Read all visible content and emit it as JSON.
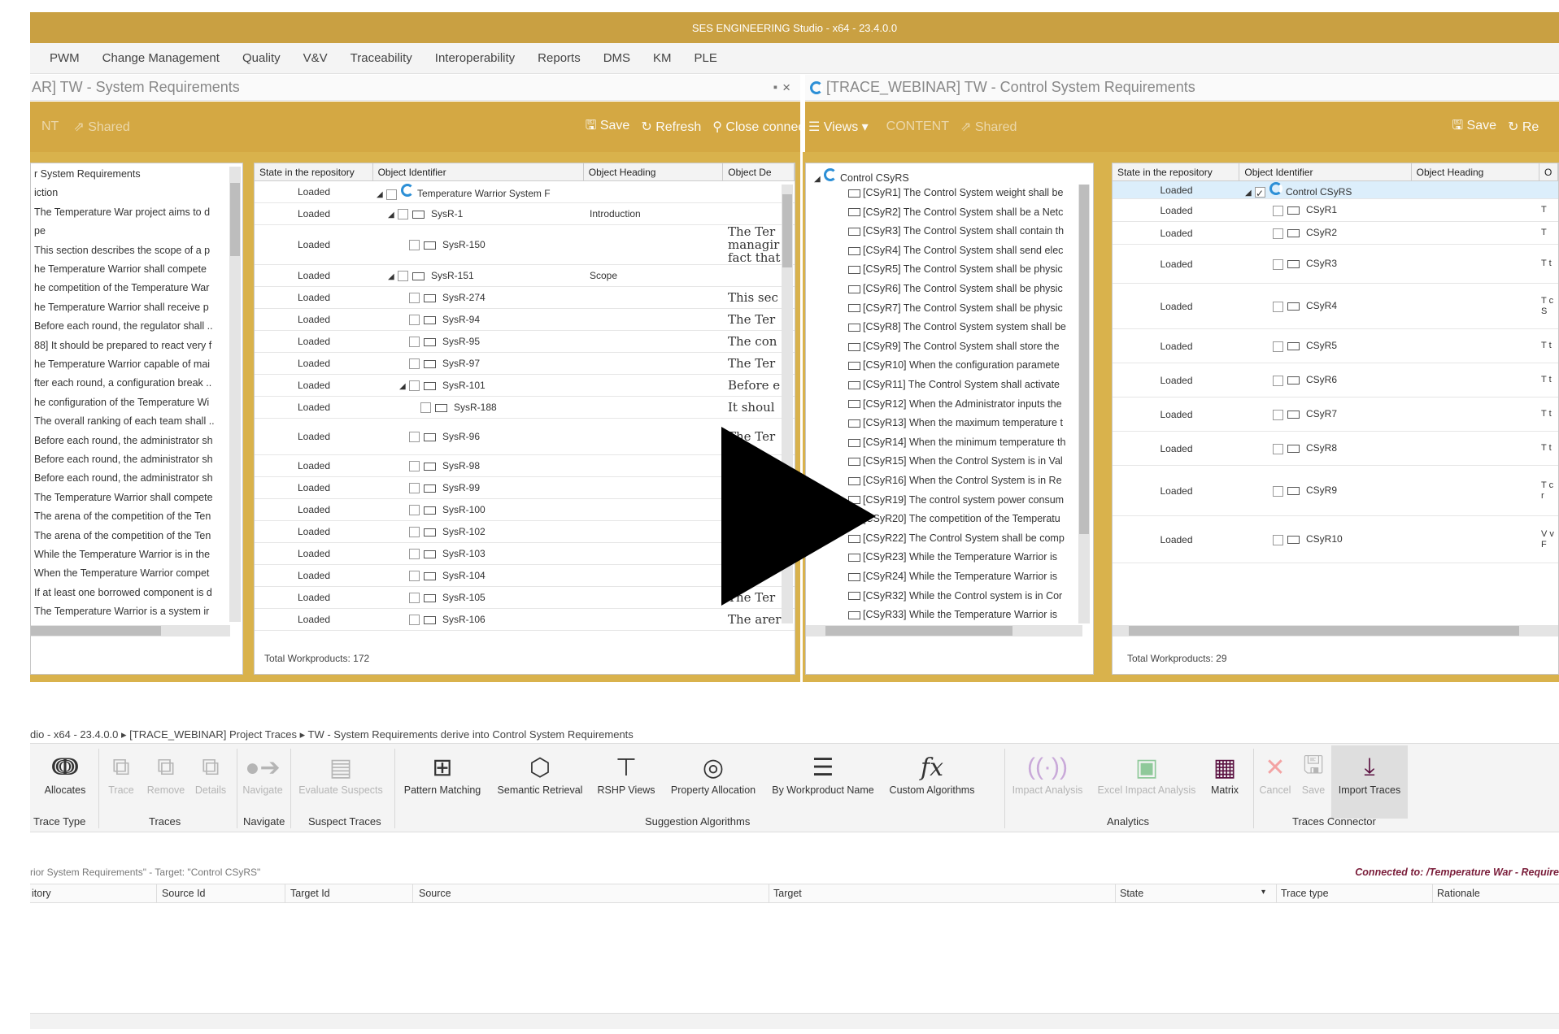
{
  "app": {
    "title": "SES ENGINEERING Studio - x64 - 23.4.0.0"
  },
  "menu": [
    "PWM",
    "Change Management",
    "Quality",
    "V&V",
    "Traceability",
    "Interoperability",
    "Reports",
    "DMS",
    "KM",
    "PLE"
  ],
  "left_tab": {
    "title": "AR] TW - System Requirements",
    "pin": "▪",
    "close": "×"
  },
  "right_tab": {
    "title": "[TRACE_WEBINAR] TW - Control System Requirements"
  },
  "left_toolbar": {
    "content": "NT",
    "shared": "Shared",
    "save": "Save",
    "refresh": "Refresh",
    "close_connection": "Close connection"
  },
  "right_toolbar": {
    "views": "Views",
    "content": "CONTENT",
    "shared": "Shared",
    "save": "Save",
    "refresh": "Re"
  },
  "left_tree": {
    "items": [
      "r System Requirements",
      "iction",
      "The Temperature War project aims to d",
      "pe",
      "This section describes the scope of a p",
      "he Temperature Warrior shall compete",
      "he competition of the Temperature War",
      "he Temperature Warrior shall receive p",
      "Before each round, the regulator shall ..",
      "88] It should be prepared to react very f",
      "he Temperature Warrior capable of mai",
      "fter each round, a configuration break ..",
      "he configuration of the Temperature Wi",
      "The overall ranking of each team shall ..",
      "Before each round, the administrator sh",
      "Before each round, the administrator sh",
      "Before each round, the administrator sh",
      "The Temperature Warrior shall compete",
      "The arena of the competition of the Ten",
      "The arena of the competition of the Ten",
      "While the Temperature Warrior is in the",
      "When the Temperature Warrior compet",
      "If at least one borrowed component is d",
      "The Temperature Warrior is a system ir"
    ]
  },
  "left_table": {
    "headers": [
      "State in the repository",
      "Object Identifier",
      "Object Heading",
      "Object De"
    ],
    "rows": [
      {
        "state": "Loaded",
        "id": "Temperature Warrior System F",
        "heading": "",
        "desc": ""
      },
      {
        "state": "Loaded",
        "id": "SysR-1",
        "heading": "Introduction",
        "desc": ""
      },
      {
        "state": "Loaded",
        "id": "SysR-150",
        "heading": "",
        "desc": "The Ter managir fact that"
      },
      {
        "state": "Loaded",
        "id": "SysR-151",
        "heading": "Scope",
        "desc": ""
      },
      {
        "state": "Loaded",
        "id": "SysR-274",
        "heading": "",
        "desc": "This sec"
      },
      {
        "state": "Loaded",
        "id": "SysR-94",
        "heading": "",
        "desc": "The Ter"
      },
      {
        "state": "Loaded",
        "id": "SysR-95",
        "heading": "",
        "desc": "The con"
      },
      {
        "state": "Loaded",
        "id": "SysR-97",
        "heading": "",
        "desc": "The Ter"
      },
      {
        "state": "Loaded",
        "id": "SysR-101",
        "heading": "",
        "desc": "Before e"
      },
      {
        "state": "Loaded",
        "id": "SysR-188",
        "heading": "",
        "desc": "It shoul"
      },
      {
        "state": "Loaded",
        "id": "SysR-96",
        "heading": "",
        "desc": "The Ter"
      },
      {
        "state": "Loaded",
        "id": "SysR-98",
        "heading": "",
        "desc": ""
      },
      {
        "state": "Loaded",
        "id": "SysR-99",
        "heading": "",
        "desc": ""
      },
      {
        "state": "Loaded",
        "id": "SysR-100",
        "heading": "",
        "desc": ""
      },
      {
        "state": "Loaded",
        "id": "SysR-102",
        "heading": "",
        "desc": ""
      },
      {
        "state": "Loaded",
        "id": "SysR-103",
        "heading": "",
        "desc": ""
      },
      {
        "state": "Loaded",
        "id": "SysR-104",
        "heading": "",
        "desc": ""
      },
      {
        "state": "Loaded",
        "id": "SysR-105",
        "heading": "",
        "desc": "The Ter"
      },
      {
        "state": "Loaded",
        "id": "SysR-106",
        "heading": "",
        "desc": "The arer"
      }
    ],
    "total": "Total Workproducts: 172"
  },
  "right_tree": {
    "root": "Control CSyRS",
    "items": [
      "[CSyR1] The Control System weight shall be",
      "[CSyR2] The Control System shall be a Netc",
      "[CSyR3] The Control System shall contain th",
      "[CSyR4] The Control System shall send elec",
      "[CSyR5] The Control System shall be physic",
      "[CSyR6] The Control System shall be physic",
      "[CSyR7] The Control System shall be physic",
      "[CSyR8] The Control System system shall be",
      "[CSyR9] The Control System shall store the",
      "[CSyR10] When the configuration paramete",
      "[CSyR11] The Control System shall activate",
      "[CSyR12] When the Administrator inputs the",
      "[CSyR13] When the maximum temperature t",
      "[CSyR14] When the minimum temperature th",
      "[CSyR15] When the Control System is in Val",
      "[CSyR16] When the Control System is in Re",
      "[CSyR19] The control system power consum",
      "[CSyR20] The competition of the Temperatu",
      "[CSyR22] The Control System shall be comp",
      "[CSyR23] While the Temperature Warrior is",
      "[CSyR24] While the Temperature Warrior is",
      "[CSyR32] While the Control system is in Cor",
      "[CSyR33] While the Temperature Warrior is"
    ]
  },
  "right_table": {
    "headers": [
      "State in the repository",
      "Object Identifier",
      "Object Heading",
      "O"
    ],
    "rows": [
      {
        "state": "Loaded",
        "id": "Control CSyRS",
        "desc": ""
      },
      {
        "state": "Loaded",
        "id": "CSyR1",
        "desc": "T"
      },
      {
        "state": "Loaded",
        "id": "CSyR2",
        "desc": "T"
      },
      {
        "state": "Loaded",
        "id": "CSyR3",
        "desc": "T t"
      },
      {
        "state": "Loaded",
        "id": "CSyR4",
        "desc": "T c S"
      },
      {
        "state": "Loaded",
        "id": "CSyR5",
        "desc": "T t"
      },
      {
        "state": "Loaded",
        "id": "CSyR6",
        "desc": "T t"
      },
      {
        "state": "Loaded",
        "id": "CSyR7",
        "desc": "T t"
      },
      {
        "state": "Loaded",
        "id": "CSyR8",
        "desc": "T t"
      },
      {
        "state": "Loaded",
        "id": "CSyR9",
        "desc": "T c r"
      },
      {
        "state": "Loaded",
        "id": "CSyR10",
        "desc": "V v F"
      }
    ],
    "total": "Total Workproducts: 29"
  },
  "breadcrumb": "dio - x64 - 23.4.0.0 ▸ [TRACE_WEBINAR] Project Traces ▸ TW - System Requirements derive into Control System Requirements",
  "ribbon": {
    "allocates": "Allocates",
    "trace": "Trace",
    "remove": "Remove",
    "details": "Details",
    "navigate": "Navigate",
    "evaluate_suspects": "Evaluate Suspects",
    "pattern_matching": "Pattern Matching",
    "semantic_retrieval": "Semantic Retrieval",
    "rshp_views": "RSHP Views",
    "property_allocation": "Property Allocation",
    "by_workproduct_name": "By Workproduct Name",
    "custom_algorithms": "Custom Algorithms",
    "impact_analysis": "Impact Analysis",
    "excel_impact_analysis": "Excel Impact Analysis",
    "matrix": "Matrix",
    "cancel": "Cancel",
    "save": "Save",
    "import_traces": "Import Traces",
    "groups": {
      "trace_type": "Trace Type",
      "traces": "Traces",
      "navigate": "Navigate",
      "suspect_traces": "Suspect Traces",
      "suggestion_algorithms": "Suggestion Algorithms",
      "analytics": "Analytics",
      "traces_connector": "Traces Connector"
    }
  },
  "trace_info": "rior System Requirements\" - Target: \"Control CSyRS\"",
  "connected": "Connected to: /Temperature War - Require",
  "trace_columns": [
    "itory",
    "Source Id",
    "Target Id",
    "Source",
    "Target",
    "State",
    "Trace type",
    "Rationale"
  ],
  "colors": {
    "accent": "#d4a843",
    "titlebar": "#c9a042",
    "link": "#2c8fd6"
  }
}
